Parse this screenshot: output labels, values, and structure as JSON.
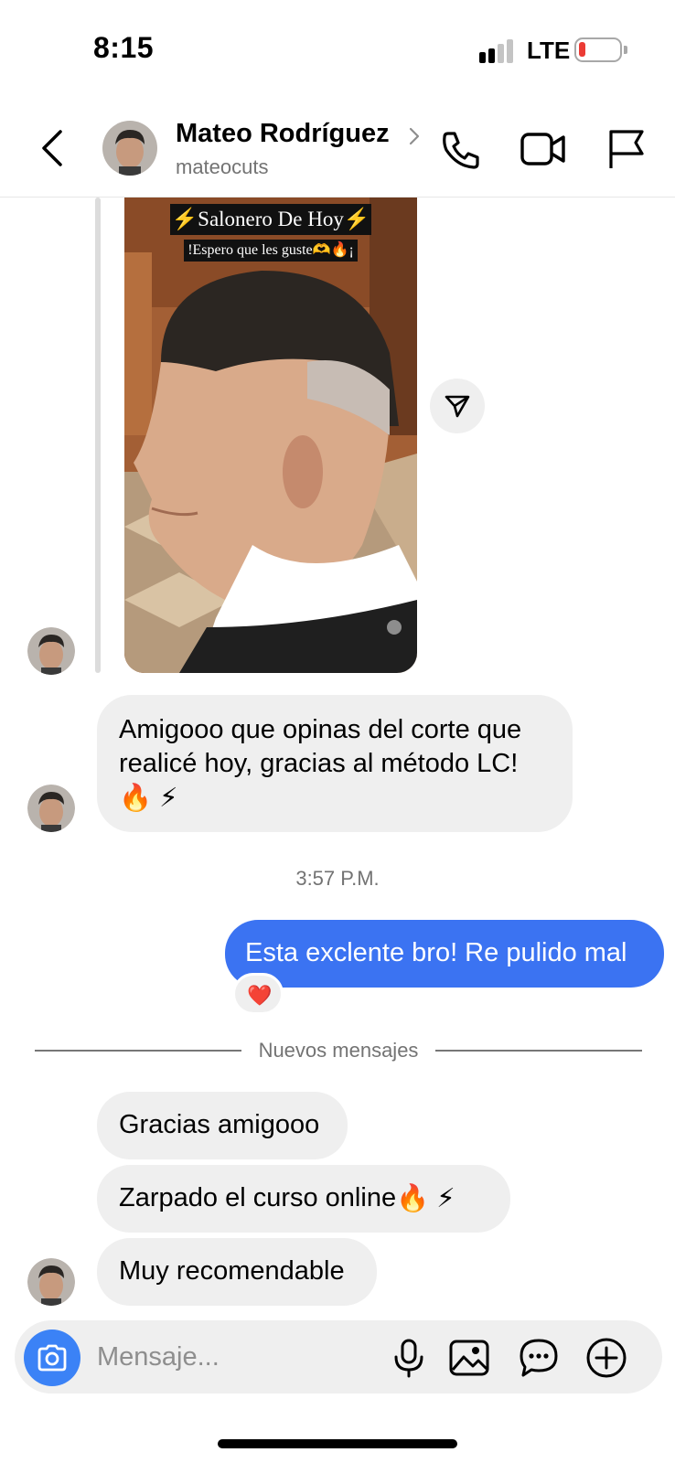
{
  "status_bar": {
    "time": "8:15",
    "network": "LTE",
    "battery_color": "#eb3b35"
  },
  "header": {
    "contact_name": "Mateo Rodríguez",
    "contact_handle": "mateocuts",
    "icons": [
      "back-icon",
      "call-icon",
      "video-call-icon",
      "flag-icon"
    ]
  },
  "shared_post": {
    "title": "⚡Salonero De Hoy⚡",
    "subtitle": "!Espero que les guste🫶🔥¡"
  },
  "messages": [
    {
      "id": "m1",
      "direction": "incoming",
      "text": "Amigooo que opinas del corte que realicé hoy, gracias al método LC!",
      "emojis": "🔥 ⚡"
    },
    {
      "id": "m2",
      "direction": "outgoing",
      "text": "Esta exclente bro! Re pulido mal",
      "reaction": "❤️"
    },
    {
      "id": "m3",
      "direction": "incoming",
      "text": "Gracias amigooo"
    },
    {
      "id": "m4",
      "direction": "incoming",
      "text": "Zarpado el curso online",
      "emojis": "🔥 ⚡"
    },
    {
      "id": "m5",
      "direction": "incoming",
      "text": "Muy recomendable"
    }
  ],
  "timestamp": "3:57 P.M.",
  "divider_label": "Nuevos mensajes",
  "composer": {
    "placeholder": "Mensaje...",
    "value": ""
  },
  "colors": {
    "outgoing_bubble": "#3b73f2",
    "incoming_bubble": "#efefef",
    "camera_button": "#3b82f6"
  }
}
